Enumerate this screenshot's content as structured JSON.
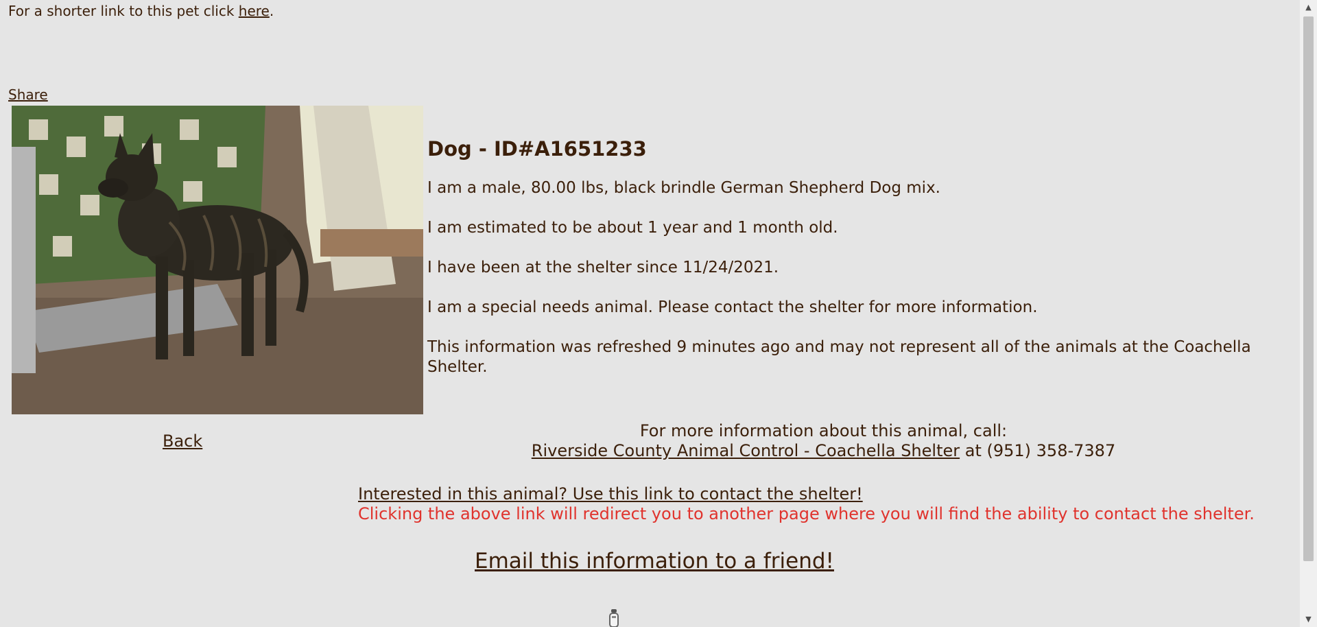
{
  "header": {
    "shorter_link_prefix": "For a shorter link to this pet click ",
    "shorter_link_text": "here",
    "shorter_link_suffix": ".",
    "share_label": "Share"
  },
  "animal": {
    "title": "Dog - ID#A1651233",
    "description": "I am a male, 80.00 lbs, black brindle German Shepherd Dog mix.",
    "age": "I am estimated to be about 1 year and 1 month old.",
    "shelter_since": "I have been at the shelter since 11/24/2021.",
    "special_needs": "I am a special needs animal. Please contact the shelter for more information.",
    "refresh_note": "This information was refreshed 9 minutes ago and may not represent all of the animals at the Coachella Shelter."
  },
  "nav": {
    "back_label": "Back"
  },
  "contact": {
    "intro": "For more information about this animal, call:",
    "shelter_name": "Riverside County Animal Control - Coachella Shelter",
    "phone_prefix": " at ",
    "phone": "(951) 358-7387"
  },
  "interest": {
    "link_text": "Interested in this animal? Use this link to contact the shelter!",
    "note": "Clicking the above link will redirect you to another page where you will find the ability to contact the shelter.",
    "note_color": "#e0332d"
  },
  "email": {
    "link_text": "Email this information to a friend!"
  },
  "theme": {
    "background": "#e5e5e5",
    "text_color": "#3b1f0a"
  },
  "icons": {
    "scroll_up": "scroll-up-arrow-icon",
    "scroll_down": "scroll-down-arrow-icon",
    "loading": "loading-spinner-icon"
  }
}
